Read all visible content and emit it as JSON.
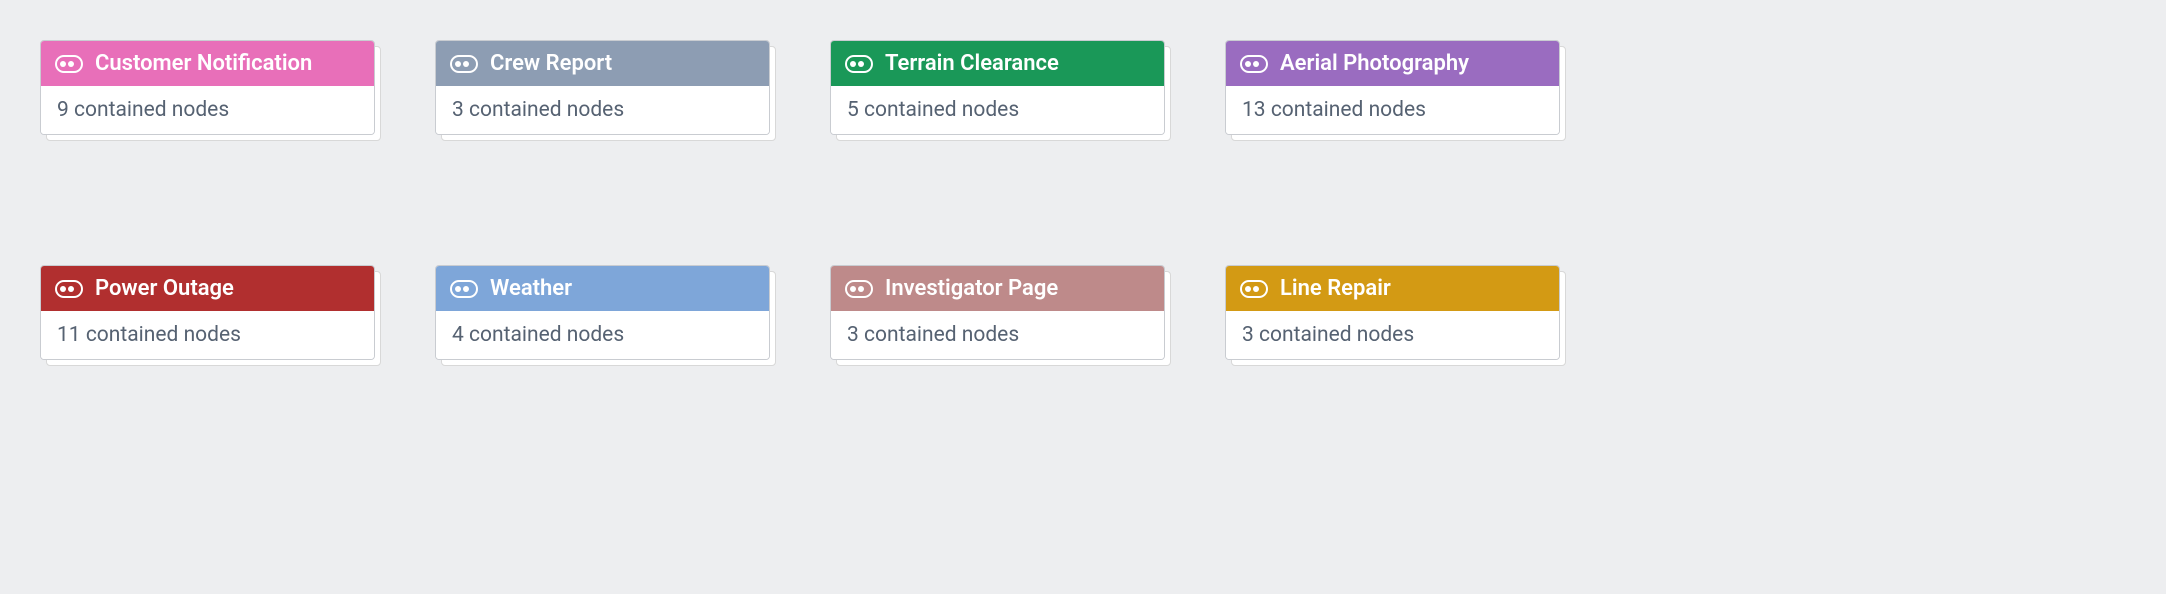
{
  "cards": [
    {
      "title": "Customer Notification",
      "body": "9 contained nodes",
      "color": "#e86fb9"
    },
    {
      "title": "Crew Report",
      "body": "3 contained nodes",
      "color": "#8d9db3"
    },
    {
      "title": "Terrain Clearance",
      "body": "5 contained nodes",
      "color": "#1a9858"
    },
    {
      "title": "Aerial Photography",
      "body": "13 contained nodes",
      "color": "#9a6cc0"
    },
    {
      "title": "Power Outage",
      "body": "11 contained nodes",
      "color": "#b12f2f"
    },
    {
      "title": "Weather",
      "body": "4 contained nodes",
      "color": "#7ea6d9"
    },
    {
      "title": "Investigator Page",
      "body": "3 contained nodes",
      "color": "#be8a8a"
    },
    {
      "title": "Line Repair",
      "body": "3 contained nodes",
      "color": "#d39a14"
    }
  ]
}
